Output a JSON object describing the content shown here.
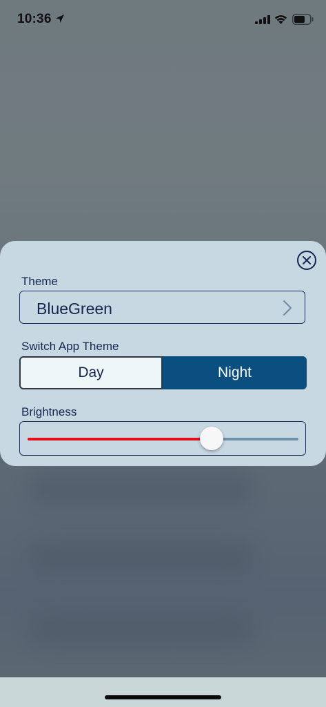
{
  "status_bar": {
    "time": "10:36",
    "icons": [
      "location-arrow-icon",
      "cellular-signal-icon",
      "wifi-icon",
      "battery-icon"
    ]
  },
  "panel": {
    "close_icon": "close-circle-icon",
    "theme": {
      "label": "Theme",
      "value": "BlueGreen",
      "chevron_icon": "chevron-right-icon"
    },
    "switch_theme": {
      "label": "Switch App Theme",
      "options": [
        "Day",
        "Night"
      ],
      "selected": "Day"
    },
    "brightness": {
      "label": "Brightness",
      "value_fraction": 0.68
    }
  },
  "colors": {
    "panel_background": "#c7d8e2",
    "text_navy": "#14254f",
    "night_selected_bg": "#0b4f80",
    "slider_fill": "#e3101b",
    "slider_track": "#6f91aa"
  }
}
